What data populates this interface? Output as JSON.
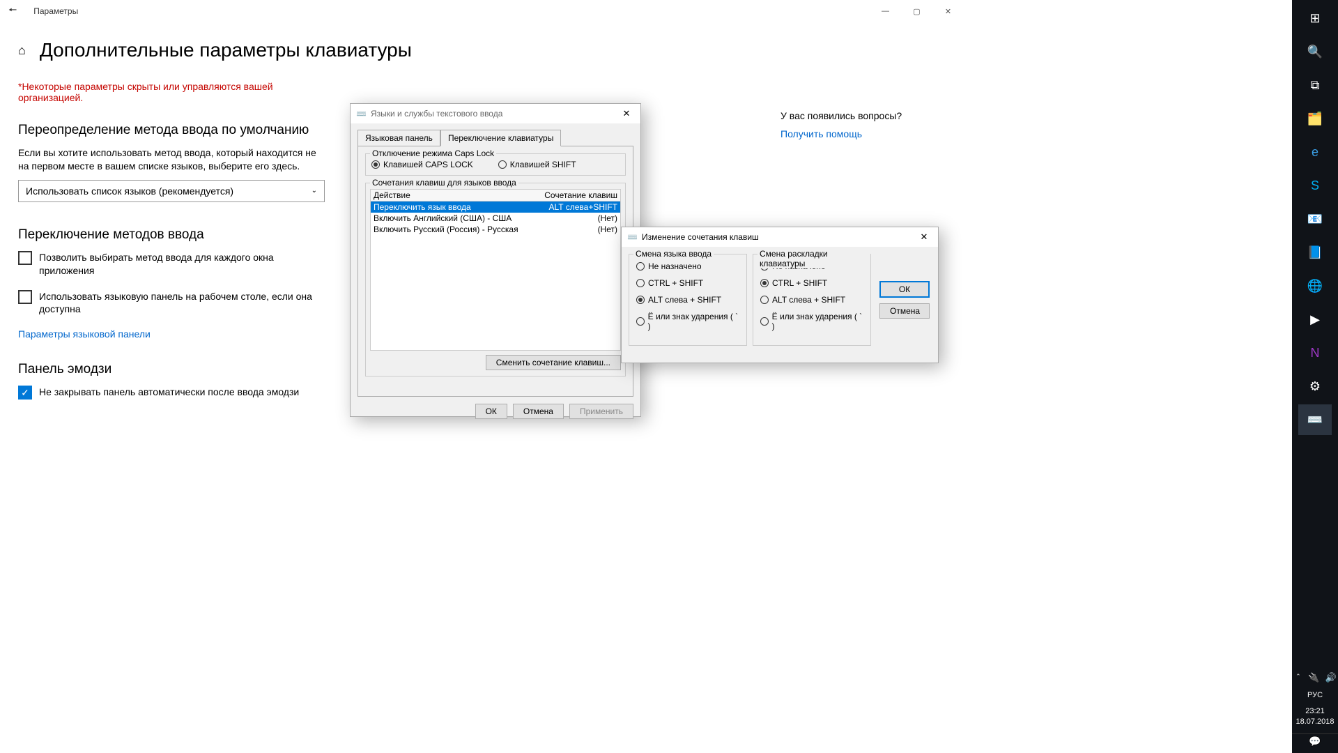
{
  "window": {
    "title": "Параметры"
  },
  "page": {
    "title": "Дополнительные параметры клавиатуры",
    "warning": "*Некоторые параметры скрыты или управляются вашей организацией.",
    "sec1_h": "Переопределение метода ввода по умолчанию",
    "sec1_p": "Если вы хотите использовать метод ввода, который находится не на первом месте в вашем списке языков, выберите его здесь.",
    "combo": "Использовать список языков (рекомендуется)",
    "sec2_h": "Переключение методов ввода",
    "chk1": "Позволить выбирать метод ввода для каждого окна приложения",
    "chk2": "Использовать языковую панель на рабочем столе, если она доступна",
    "link1": "Параметры языковой панели",
    "sec3_h": "Панель эмодзи",
    "chk3": "Не закрывать панель автоматически после ввода эмодзи",
    "help_q": "У вас появились вопросы?",
    "help_link": "Получить помощь"
  },
  "dlg1": {
    "title": "Языки и службы текстового ввода",
    "tab1": "Языковая панель",
    "tab2": "Переключение клавиатуры",
    "grp1": "Отключение режима Caps Lock",
    "r1": "Клавишей CAPS LOCK",
    "r2": "Клавишей SHIFT",
    "grp2": "Сочетания клавиш для языков ввода",
    "col1": "Действие",
    "col2": "Сочетание клавиш",
    "rows": [
      {
        "a": "Переключить язык ввода",
        "k": "ALT слева+SHIFT"
      },
      {
        "a": "Включить Английский (США) - США",
        "k": "(Нет)"
      },
      {
        "a": "Включить Русский (Россия) - Русская",
        "k": "(Нет)"
      }
    ],
    "change": "Сменить сочетание клавиш...",
    "ok": "ОК",
    "cancel": "Отмена",
    "apply": "Применить"
  },
  "dlg2": {
    "title": "Изменение сочетания клавиш",
    "col1": "Смена языка ввода",
    "col2": "Смена раскладки клавиатуры",
    "opts": [
      "Не назначено",
      "CTRL + SHIFT",
      "ALT слева + SHIFT",
      "Ё или знак ударения ( ` )"
    ],
    "ok": "ОК",
    "cancel": "Отмена"
  },
  "tray": {
    "lang": "РУС",
    "time": "23:21",
    "date": "18.07.2018"
  }
}
